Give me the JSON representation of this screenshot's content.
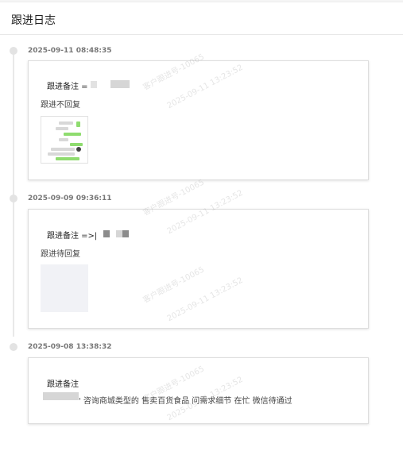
{
  "header": {
    "title": "跟进日志"
  },
  "entries": [
    {
      "time": "2025-09-11 08:48:35",
      "note_label": "跟进备注 =",
      "body": "跟进不回复"
    },
    {
      "time": "2025-09-09 09:36:11",
      "note_label": "跟进备注 =>|",
      "body": "跟进待回复"
    },
    {
      "time": "2025-09-08 13:38:32",
      "note_label": "跟进备注",
      "body": "' 咨询商城类型的 售卖百货食品 问需求细节 在忙 微信待通过"
    }
  ],
  "watermark": {
    "line1": "客户跟进号-10065",
    "line2": "2025-09-11 13:23:52"
  }
}
